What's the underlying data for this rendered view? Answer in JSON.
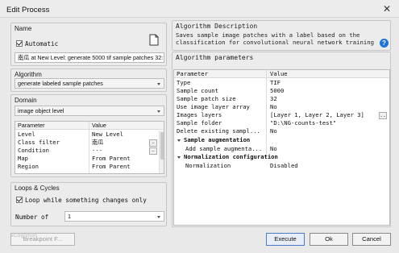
{
  "window": {
    "title": "Edit Process"
  },
  "name_group": {
    "title": "Name",
    "automatic_label": "Automatic",
    "process_name": "南瓜 at New Level: generate 5000 tif sample patches 32:"
  },
  "algorithm_group": {
    "title": "Algorithm",
    "selected": "generate labeled sample patches"
  },
  "domain_group": {
    "title": "Domain",
    "selected": "image object level",
    "columns": [
      "Parameter",
      "Value"
    ],
    "rows": [
      {
        "param": "Level",
        "value": "New Level"
      },
      {
        "param": "Class filter",
        "value": "南瓜"
      },
      {
        "param": "Condition",
        "value": "---"
      },
      {
        "param": "Map",
        "value": "From Parent"
      },
      {
        "param": "Region",
        "value": "From Parent"
      }
    ]
  },
  "loops_group": {
    "title": "Loops & Cycles",
    "loop_label": "Loop while something changes only",
    "number_of_label": "Number of",
    "number_value": "1"
  },
  "description_group": {
    "title": "Algorithm Description",
    "text": "Saves sample image patches with a label based on the classification for convolutional neural network training"
  },
  "params_group": {
    "title": "Algorithm parameters",
    "columns": [
      "Parameter",
      "Value"
    ],
    "rows": [
      {
        "param": "Type",
        "value": "TIF"
      },
      {
        "param": "Sample count",
        "value": "5000"
      },
      {
        "param": "Sample patch size",
        "value": "32"
      },
      {
        "param": "Use image layer array",
        "value": "No"
      },
      {
        "param": "Images layers",
        "value": "[Layer 1, Layer 2, Layer 3]"
      },
      {
        "param": "Sample folder",
        "value": "\"D:\\NG-counts-test\""
      },
      {
        "param": "Delete existing sampl...",
        "value": "No"
      }
    ],
    "section_augmentation": "Sample augmentation",
    "augmentation_rows": [
      {
        "param": "Add sample augmenta...",
        "value": "No"
      }
    ],
    "section_normalization": "Normalization configuration",
    "normalization_rows": [
      {
        "param": "Normalization",
        "value": "Disabled"
      }
    ]
  },
  "buttons": {
    "breakpoint": "Breakpoint F...",
    "execute": "Execute",
    "ok": "Ok",
    "cancel": "Cancel"
  },
  "watermark": "eCognition"
}
